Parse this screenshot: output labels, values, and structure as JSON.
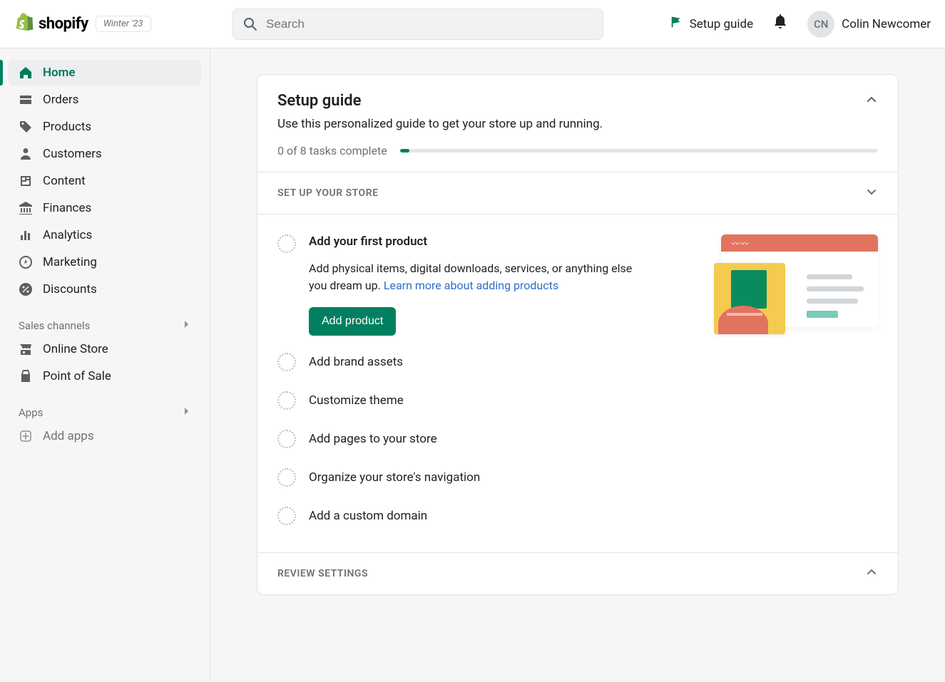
{
  "header": {
    "brand": "shopify",
    "badge": "Winter '23",
    "search_placeholder": "Search",
    "setup_guide_label": "Setup guide",
    "user_initials": "CN",
    "user_name": "Colin Newcomer"
  },
  "sidebar": {
    "nav": [
      {
        "id": "home",
        "label": "Home",
        "icon": "home-icon",
        "active": true
      },
      {
        "id": "orders",
        "label": "Orders",
        "icon": "inbox-icon"
      },
      {
        "id": "products",
        "label": "Products",
        "icon": "tag-icon"
      },
      {
        "id": "customers",
        "label": "Customers",
        "icon": "person-icon"
      },
      {
        "id": "content",
        "label": "Content",
        "icon": "content-icon"
      },
      {
        "id": "finances",
        "label": "Finances",
        "icon": "bank-icon"
      },
      {
        "id": "analytics",
        "label": "Analytics",
        "icon": "bars-icon"
      },
      {
        "id": "marketing",
        "label": "Marketing",
        "icon": "target-icon"
      },
      {
        "id": "discounts",
        "label": "Discounts",
        "icon": "percent-icon"
      }
    ],
    "sales_channels_label": "Sales channels",
    "sales_channels": [
      {
        "id": "online-store",
        "label": "Online Store",
        "icon": "store-icon"
      },
      {
        "id": "pos",
        "label": "Point of Sale",
        "icon": "pos-icon"
      }
    ],
    "apps_label": "Apps",
    "add_apps_label": "Add apps"
  },
  "setup_guide": {
    "title": "Setup guide",
    "subtitle": "Use this personalized guide to get your store up and running.",
    "progress_text": "0 of 8 tasks complete",
    "progress_percent": 2,
    "sections": [
      {
        "id": "setup-store",
        "label": "Set up your store",
        "expanded": true,
        "tasks": [
          {
            "id": "add-product",
            "title": "Add your first product",
            "expanded": true,
            "description": "Add physical items, digital downloads, services, or anything else you dream up.",
            "link_text": "Learn more about adding products",
            "cta": "Add product"
          },
          {
            "id": "brand-assets",
            "title": "Add brand assets"
          },
          {
            "id": "customize-theme",
            "title": "Customize theme"
          },
          {
            "id": "add-pages",
            "title": "Add pages to your store"
          },
          {
            "id": "organize-nav",
            "title": "Organize your store's navigation"
          },
          {
            "id": "custom-domain",
            "title": "Add a custom domain"
          }
        ]
      },
      {
        "id": "review-settings",
        "label": "Review settings",
        "expanded": false
      }
    ]
  },
  "colors": {
    "accent": "#008060",
    "link": "#2c6ecb"
  }
}
